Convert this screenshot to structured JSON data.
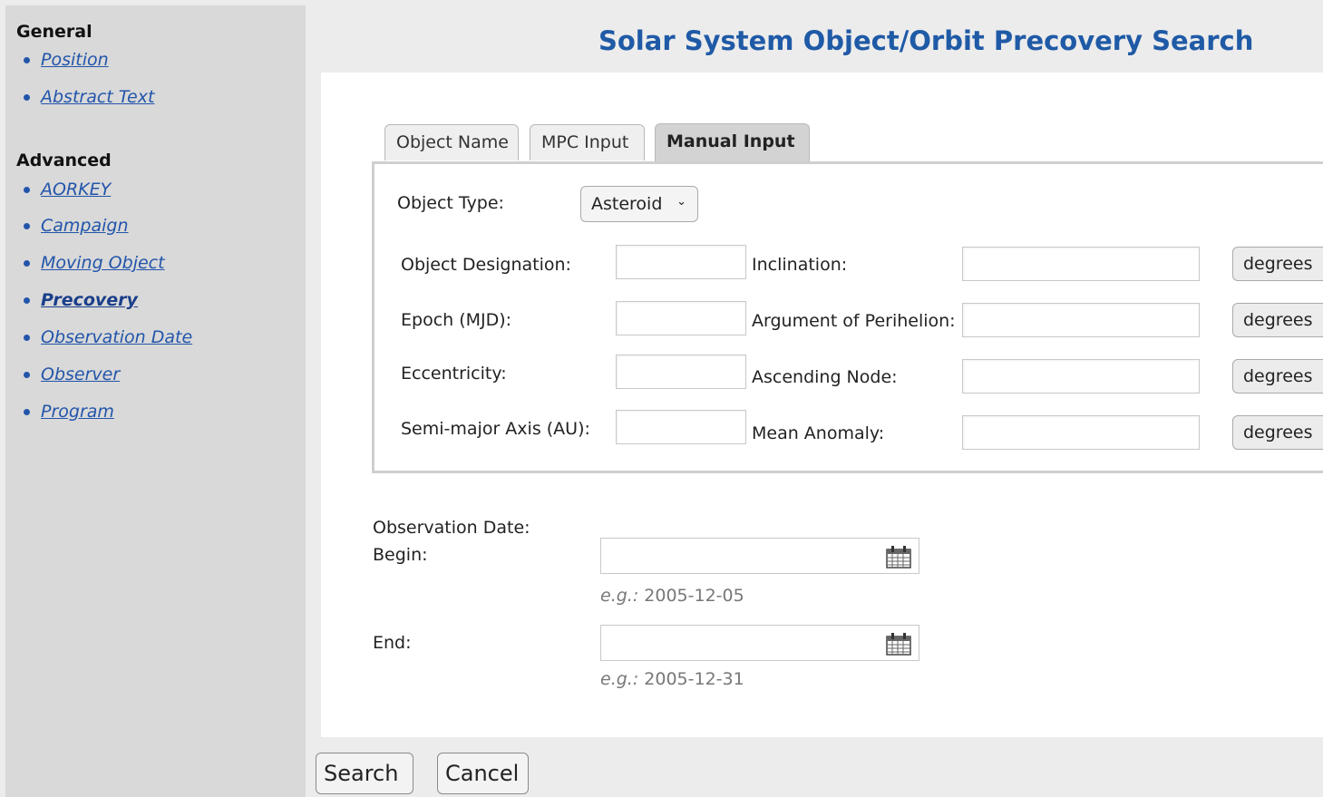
{
  "sidebar": {
    "general_title": "General",
    "general_items": [
      {
        "label": "Position"
      },
      {
        "label": "Abstract Text"
      }
    ],
    "advanced_title": "Advanced",
    "advanced_items": [
      {
        "label": "AORKEY"
      },
      {
        "label": "Campaign"
      },
      {
        "label": "Moving Object"
      },
      {
        "label": "Precovery",
        "active": true
      },
      {
        "label": "Observation Date"
      },
      {
        "label": "Observer"
      },
      {
        "label": "Program"
      }
    ]
  },
  "page_title": "Solar System Object/Orbit Precovery Search",
  "tabs": [
    {
      "label": "Object Name"
    },
    {
      "label": "MPC Input"
    },
    {
      "label": "Manual Input",
      "active": true
    }
  ],
  "form": {
    "object_type_label": "Object Type:",
    "object_type_value": "Asteroid",
    "left_fields": [
      {
        "label": "Object Designation:",
        "value": ""
      },
      {
        "label": "Epoch (MJD):",
        "value": ""
      },
      {
        "label": "Eccentricity:",
        "value": ""
      },
      {
        "label": "Semi-major Axis (AU):",
        "value": ""
      }
    ],
    "right_fields": [
      {
        "label": "Inclination:",
        "value": "",
        "unit": "degrees"
      },
      {
        "label": "Argument of Perihelion:",
        "value": "",
        "unit": "degrees"
      },
      {
        "label": "Ascending Node:",
        "value": "",
        "unit": "degrees"
      },
      {
        "label": "Mean Anomaly:",
        "value": "",
        "unit": "degrees"
      }
    ]
  },
  "dates": {
    "section_label": "Observation Date:",
    "begin_label": "Begin:",
    "begin_value": "",
    "begin_hint_prefix": "e.g.:",
    "begin_hint": "2005-12-05",
    "end_label": "End:",
    "end_value": "",
    "end_hint_prefix": "e.g.:",
    "end_hint": "2005-12-31"
  },
  "buttons": {
    "search": "Search",
    "cancel": "Cancel"
  },
  "icons": {
    "calendar": "calendar-icon",
    "bullet": "bullet-icon",
    "chevron": "chevron-down-icon"
  }
}
